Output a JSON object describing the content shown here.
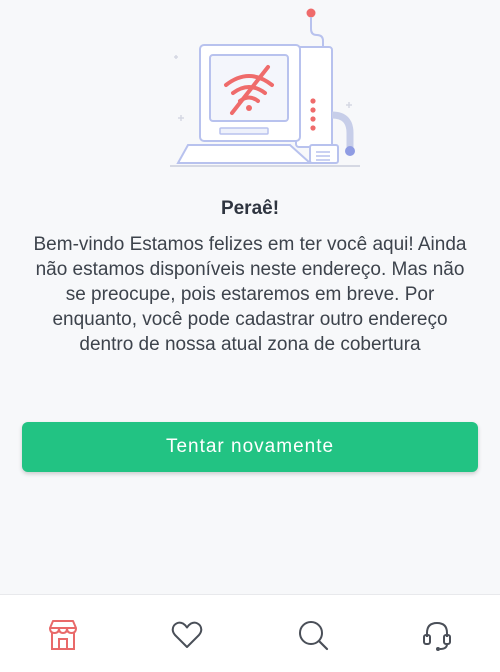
{
  "empty_state": {
    "title": "Peraê!",
    "message": "Bem-vindo Estamos felizes em ter você aqui! Ainda não estamos disponíveis neste endereço. Mas não se preocupe, pois estaremos em breve. Por enquanto, você pode cadastrar outro endereço dentro de nossa atual zona de cobertura",
    "illustration_icon": "computer-no-wifi-illustration"
  },
  "retry_button": {
    "label": "Tentar novamente",
    "color": "#22c383"
  },
  "bottom_nav": {
    "items": [
      {
        "icon": "store-icon",
        "active": true,
        "color": "#e96a6a"
      },
      {
        "icon": "heart-icon",
        "active": false,
        "color": "#4a4f58"
      },
      {
        "icon": "search-icon",
        "active": false,
        "color": "#4a4f58"
      },
      {
        "icon": "headset-icon",
        "active": false,
        "color": "#4a4f58"
      }
    ]
  }
}
